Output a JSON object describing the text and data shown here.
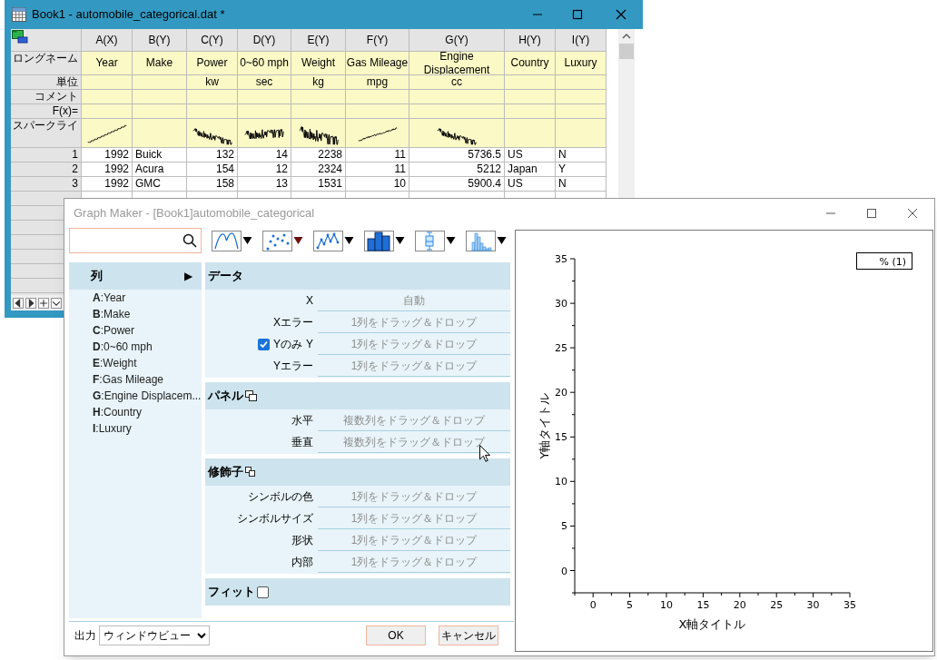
{
  "book_window": {
    "title": "Book1 - automobile_categorical.dat *",
    "row_labels": {
      "long_name": "ロングネーム",
      "units": "単位",
      "comment": "コメント",
      "formula": "F(x)=",
      "sparkline": "スパークライ"
    },
    "columns": [
      {
        "name": "A(X)",
        "long_name": "Year",
        "kind": "number",
        "sparkline": {
          "kind": "up"
        }
      },
      {
        "name": "B(Y)",
        "long_name": "Make",
        "kind": "text"
      },
      {
        "name": "C(Y)",
        "long_name": "Power",
        "units": "kw",
        "kind": "number",
        "sparkline": {
          "kind": "down"
        }
      },
      {
        "name": "D(Y)",
        "long_name": "0~60 mph",
        "units": "sec",
        "kind": "number",
        "sparkline": {
          "kind": "flat"
        }
      },
      {
        "name": "E(Y)",
        "long_name": "Weight",
        "units": "kg",
        "kind": "number",
        "sparkline": {
          "kind": "dense"
        }
      },
      {
        "name": "F(Y)",
        "long_name": "Gas Mileage",
        "units": "mpg",
        "kind": "number",
        "sparkline": {
          "kind": "smooth"
        }
      },
      {
        "name": "G(Y)",
        "long_name": "Engine Displacement",
        "units": "cc",
        "kind": "number",
        "sparkline": {
          "kind": "down"
        }
      },
      {
        "name": "H(Y)",
        "long_name": "Country",
        "kind": "text"
      },
      {
        "name": "I(Y)",
        "long_name": "Luxury",
        "kind": "text"
      }
    ],
    "rows": [
      {
        "index": "1",
        "cells": [
          "1992",
          "Buick",
          "132",
          "14",
          "2238",
          "11",
          "5736.5",
          "US",
          "N"
        ]
      },
      {
        "index": "2",
        "cells": [
          "1992",
          "Acura",
          "154",
          "12",
          "2324",
          "11",
          "5212",
          "Japan",
          "Y"
        ]
      },
      {
        "index": "3",
        "cells": [
          "1992",
          "GMC",
          "158",
          "13",
          "1531",
          "10",
          "5900.4",
          "US",
          "N"
        ]
      }
    ]
  },
  "graph_maker": {
    "title": "Graph Maker - [Book1]automobile_categorical",
    "plot_types": [
      {
        "kind": "line",
        "selected": false
      },
      {
        "kind": "scatter",
        "selected": true
      },
      {
        "kind": "line_symbol",
        "selected": false
      },
      {
        "kind": "column",
        "selected": false
      },
      {
        "kind": "box",
        "selected": false
      },
      {
        "kind": "histogram",
        "selected": false
      }
    ],
    "columns_panel": {
      "header": "列",
      "expander": "▶",
      "items": [
        "**A**:Year",
        "**B**:Make",
        "**C**:Power",
        "**D**:0~60 mph",
        "**E**:Weight",
        "**F**:Gas Mileage",
        "**G**:Engine Displacem...",
        "**H**:Country",
        "**I**:Luxury"
      ]
    },
    "sections": [
      {
        "title": "データ",
        "kind": "plain",
        "fields": [
          {
            "label": "X",
            "placeholder": "自動"
          },
          {
            "label": "Xエラー",
            "placeholder": "1列をドラッグ＆ドロップ"
          },
          {
            "label": "Y",
            "checkbox": {
              "label": "Yのみ",
              "checked": true
            },
            "placeholder": "1列をドラッグ＆ドロップ"
          },
          {
            "label": "Yエラー",
            "placeholder": "1列をドラッグ＆ドロップ"
          }
        ]
      },
      {
        "title": "パネル",
        "kind": "panel_icon",
        "fields": [
          {
            "label": "水平",
            "placeholder": "複数列をドラッグ＆ドロップ"
          },
          {
            "label": "垂直",
            "placeholder": "複数列をドラッグ＆ドロップ"
          }
        ]
      },
      {
        "title": "修飾子",
        "kind": "modifier_icon",
        "fields": [
          {
            "label": "シンボルの色",
            "placeholder": "1列をドラッグ＆ドロップ"
          },
          {
            "label": "シンボルサイズ",
            "placeholder": "1列をドラッグ＆ドロップ"
          },
          {
            "label": "形状",
            "placeholder": "1列をドラッグ＆ドロップ"
          },
          {
            "label": "内部",
            "placeholder": "1列をドラッグ＆ドロップ"
          }
        ]
      },
      {
        "title": "フィット",
        "kind": "checkbox",
        "checked": false
      }
    ],
    "output": {
      "label": "出力",
      "value": "ウィンドウビュー"
    },
    "buttons": [
      "OK",
      "キャンセル"
    ],
    "preview": {
      "legend": "% (1)",
      "chart_data": {
        "type": "scatter",
        "xlabel": "X軸タイトル",
        "ylabel": "Y軸タイトル",
        "xlim": [
          -2.5,
          35
        ],
        "ylim": [
          -2.5,
          35
        ],
        "xticks": [
          0,
          5,
          10,
          15,
          20,
          25,
          30,
          35
        ],
        "yticks": [
          0,
          5,
          10,
          15,
          20,
          25,
          30,
          35
        ]
      }
    }
  }
}
